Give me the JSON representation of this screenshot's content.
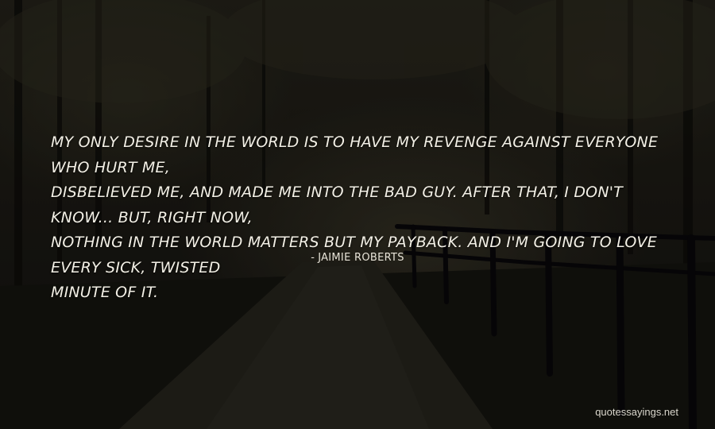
{
  "quote": {
    "lines": [
      "My only desire in the world is to have my revenge against everyone who hurt me,",
      "disbelieved me, and made me into the bad guy. After that, I don't know... but, right now,",
      "nothing in the world matters but my payback. And I'm going to love every sick, twisted",
      "minute of it."
    ],
    "author": "Jaimie Roberts"
  },
  "watermark": "quotessayings.net"
}
